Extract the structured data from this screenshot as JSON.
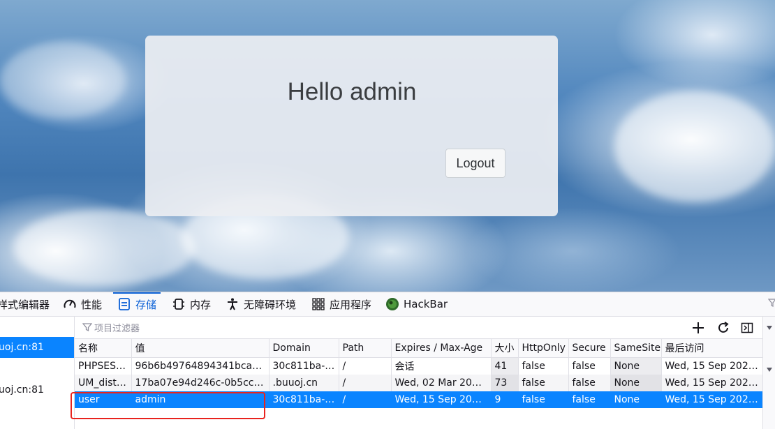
{
  "page": {
    "greeting": "Hello admin",
    "logout_label": "Logout"
  },
  "devtools": {
    "tabs": [
      {
        "label": "样式编辑器",
        "icon": "style-editor-icon"
      },
      {
        "label": "性能",
        "icon": "performance-gauge-icon"
      },
      {
        "label": "存储",
        "icon": "storage-icon",
        "selected": true
      },
      {
        "label": "内存",
        "icon": "memory-chip-icon"
      },
      {
        "label": "无障碍环境",
        "icon": "accessibility-icon"
      },
      {
        "label": "应用程序",
        "icon": "application-grid-icon"
      },
      {
        "label": "HackBar",
        "icon": "hackbar-logo-icon"
      }
    ],
    "tree": [
      {
        "label": "uoj.cn:81",
        "selected": true
      },
      {
        "label": "uoj.cn:81",
        "selected": false
      }
    ],
    "filter_placeholder": "项目过滤器",
    "columns": [
      "名称",
      "值",
      "Domain",
      "Path",
      "Expires / Max-Age",
      "大小",
      "HttpOnly",
      "Secure",
      "SameSite",
      "最后访问"
    ],
    "rows": [
      [
        "PHPSESS...",
        "96b6b49764894341bca24...",
        "30c811ba-0...",
        "/",
        "会话",
        "41",
        "false",
        "false",
        "None",
        "Wed, 15 Sep 2021..."
      ],
      [
        "UM_disti...",
        "17ba07e94d246c-0b5cc68...",
        ".buuoj.cn",
        "/",
        "Wed, 02 Mar 2022...",
        "73",
        "false",
        "false",
        "None",
        "Wed, 15 Sep 2021..."
      ],
      [
        "user",
        "admin",
        "30c811ba-0...",
        "/",
        "Wed, 15 Sep 2021...",
        "9",
        "false",
        "false",
        "None",
        "Wed, 15 Sep 2021..."
      ]
    ],
    "selected_row": 2,
    "accent_color": "#0a84ff",
    "highlight_color": "#e8231e"
  }
}
